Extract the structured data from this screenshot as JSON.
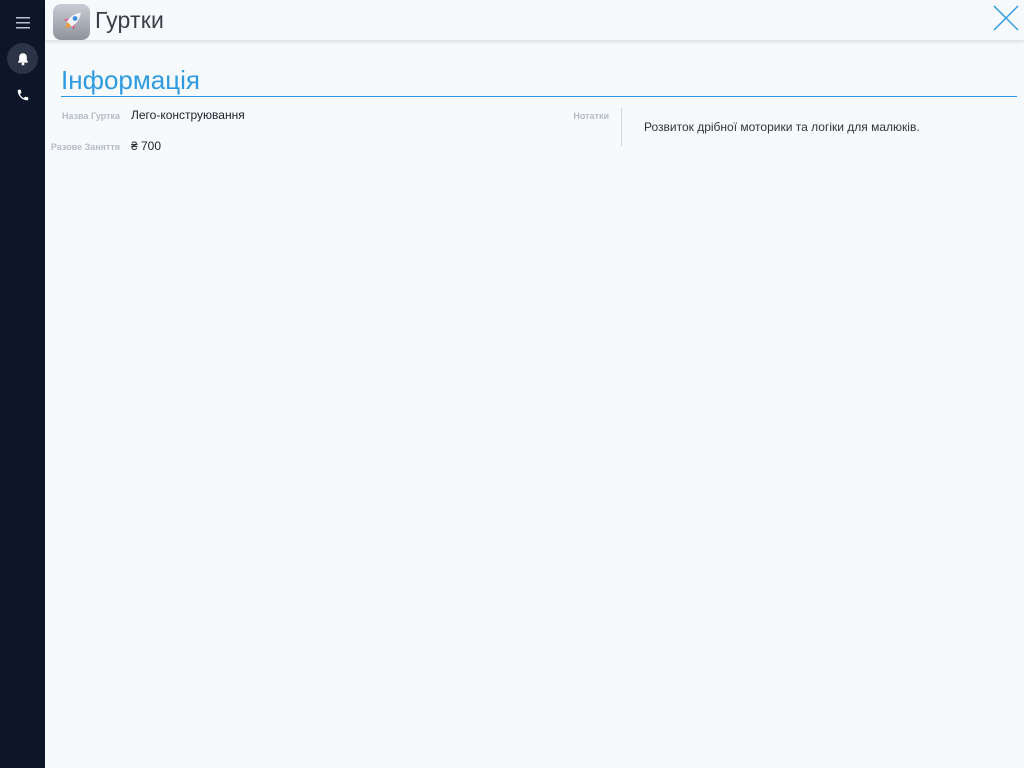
{
  "app": {
    "title": "Гуртки",
    "icon": "rocket-icon"
  },
  "sidebar": {
    "items": [
      {
        "icon": "hamburger-menu-icon"
      },
      {
        "icon": "bell-icon"
      },
      {
        "icon": "phone-icon"
      }
    ]
  },
  "section": {
    "title": "Інформація"
  },
  "fields": {
    "club_name_label": "Назва Гуртка",
    "club_name_value": "Лего-конструювання",
    "single_lesson_label": "Разове Заняття",
    "single_lesson_value": "₴ 700",
    "notes_label": "Нотатки",
    "notes_value": "Розвиток дрібної моторики та логіки для малюків."
  },
  "colors": {
    "accent": "#2e9be0",
    "sidebar_bg": "#0c1628",
    "page_bg": "#f6fafc"
  }
}
